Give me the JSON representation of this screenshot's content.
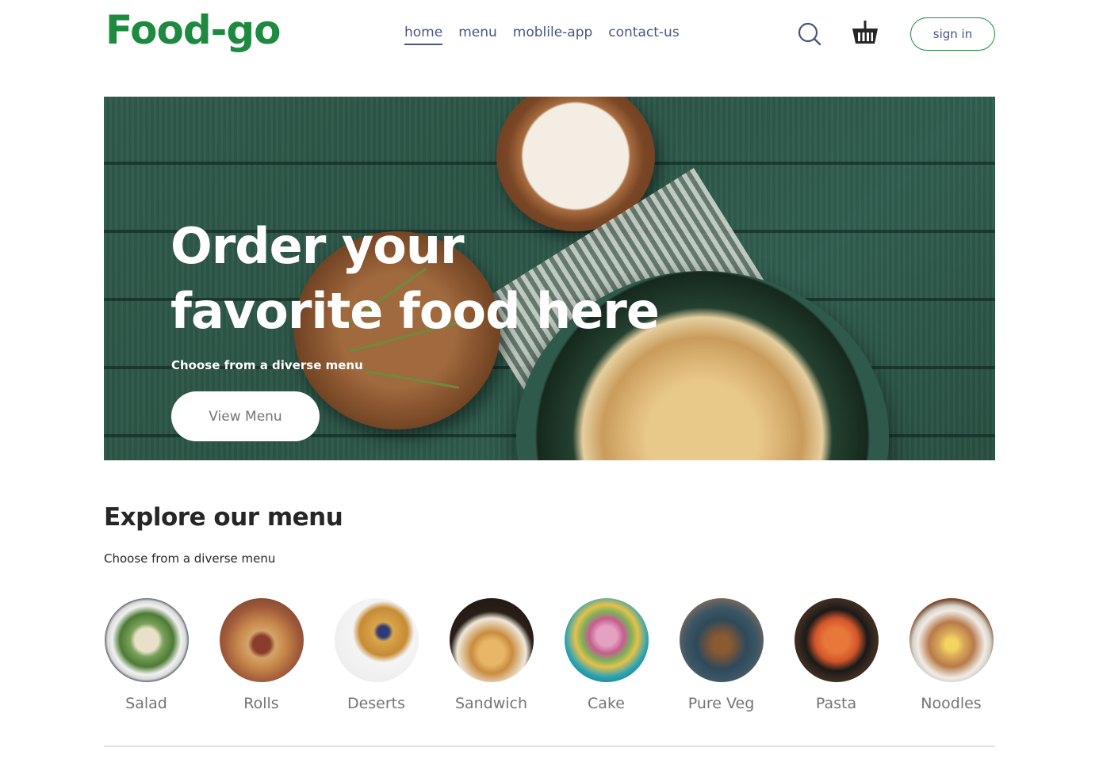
{
  "brand": {
    "logo_text": "Food-go",
    "accent": "#1d8a40"
  },
  "nav": {
    "links": [
      {
        "label": "home",
        "active": true
      },
      {
        "label": "menu",
        "active": false
      },
      {
        "label": "moblile-app",
        "active": false
      },
      {
        "label": "contact-us",
        "active": false
      }
    ],
    "search_icon": "search-icon",
    "cart_icon": "basket-icon",
    "signin_label": "sign in"
  },
  "hero": {
    "title": "Order your favorite food here",
    "subtitle": "Choose from a diverse menu",
    "button_label": "View Menu"
  },
  "explore": {
    "title": "Explore our menu",
    "subtitle": "Choose from a diverse menu",
    "items": [
      {
        "label": "Salad",
        "color": "#7aa35a"
      },
      {
        "label": "Rolls",
        "color": "#c7874a"
      },
      {
        "label": "Deserts",
        "color": "#d9a54d"
      },
      {
        "label": "Sandwich",
        "color": "#c98c3f"
      },
      {
        "label": "Cake",
        "color": "#c45e8e"
      },
      {
        "label": "Pure Veg",
        "color": "#6b5240"
      },
      {
        "label": "Pasta",
        "color": "#d3562a"
      },
      {
        "label": "Noodles",
        "color": "#b87a4a"
      }
    ]
  }
}
